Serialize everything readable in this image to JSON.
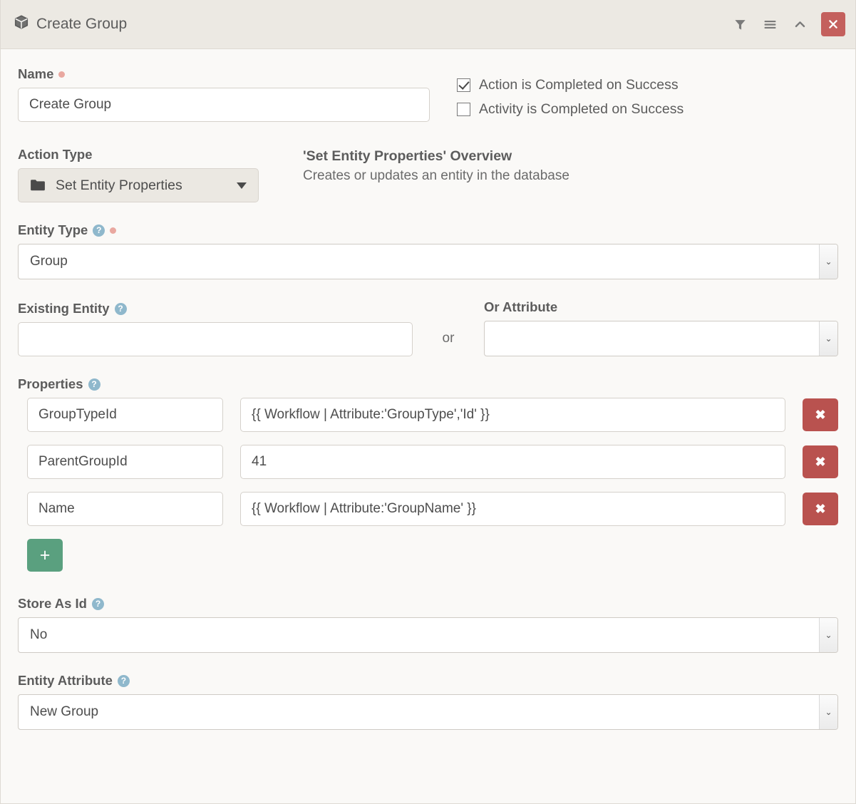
{
  "header": {
    "title": "Create Group",
    "box_icon": "box-icon",
    "actions": [
      {
        "name": "filter-icon",
        "glyph": "filter"
      },
      {
        "name": "bars-icon",
        "glyph": "bars"
      },
      {
        "name": "chevron-up-icon",
        "glyph": "chevron-up"
      }
    ],
    "close_label": "✖",
    "close_color": "#c4605d"
  },
  "form": {
    "name": {
      "label": "Name",
      "required": true,
      "value": "Create Group",
      "placeholder": ""
    },
    "checkboxes": [
      {
        "label": "Action is Completed on Success",
        "checked": true
      },
      {
        "label": "Activity is Completed on Success",
        "checked": false
      }
    ],
    "action_type": {
      "label": "Action Type",
      "value": "Set Entity Properties",
      "icon": "folder-icon"
    },
    "overview": {
      "title": "'Set Entity Properties' Overview",
      "description": "Creates or updates an entity in the database"
    },
    "entity_type": {
      "label": "Entity Type",
      "required": true,
      "help": true,
      "value": "Group"
    },
    "existing_entity": {
      "label": "Existing Entity",
      "help": true,
      "value": "",
      "placeholder": ""
    },
    "or_separator": "or",
    "or_attribute": {
      "label": "Or Attribute",
      "help": false,
      "value": ""
    },
    "properties": {
      "label": "Properties",
      "help": true,
      "rows": [
        {
          "key": "GroupTypeId",
          "value": "{{ Workflow | Attribute:'GroupType','Id' }}",
          "delete_label": "✖"
        },
        {
          "key": "ParentGroupId",
          "value": "41",
          "delete_label": "✖"
        },
        {
          "key": "Name",
          "value": "{{ Workflow | Attribute:'GroupName' }}",
          "delete_label": "✖"
        }
      ],
      "add_label": "+"
    },
    "store_as_id": {
      "label": "Store As Id",
      "help": true,
      "value": "No"
    },
    "entity_attribute": {
      "label": "Entity Attribute",
      "help": true,
      "value": "New Group"
    }
  },
  "colors": {
    "header_bg": "#ece9e3",
    "body_bg": "#faf9f7",
    "danger": "#b9524f",
    "success": "#5aa07f",
    "help": "#8fb8cc",
    "required": "#e9a8a0"
  }
}
